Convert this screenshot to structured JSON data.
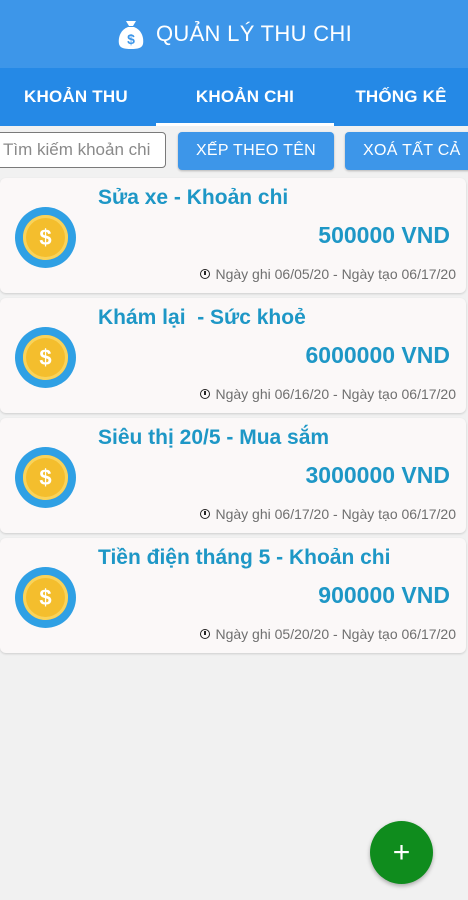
{
  "appbar": {
    "icon": "money-bag-icon",
    "title": "QUẢN LÝ THU CHI"
  },
  "tabs": [
    {
      "label": "KHOẢN THU",
      "active": false
    },
    {
      "label": "KHOẢN CHI",
      "active": true
    },
    {
      "label": "THỐNG KÊ",
      "active": false
    }
  ],
  "actions": {
    "search_placeholder": "Tìm kiếm khoản chi",
    "sort_label": "XẾP THEO TÊN",
    "clear_label": "XOÁ TẤT CẢ"
  },
  "items": [
    {
      "title": "Sửa xe - Khoản chi",
      "amount": "500000 VND",
      "dates": "Ngày ghi 06/05/20 - Ngày tạo 06/17/20"
    },
    {
      "title": "Khám lại  - Sức khoẻ",
      "amount": "6000000 VND",
      "dates": "Ngày ghi 06/16/20 - Ngày tạo 06/17/20"
    },
    {
      "title": "Siêu thị 20/5 - Mua sắm",
      "amount": "3000000 VND",
      "dates": "Ngày ghi 06/17/20 - Ngày tạo 06/17/20"
    },
    {
      "title": "Tiền điện tháng 5 - Khoản chi",
      "amount": "900000 VND",
      "dates": "Ngày ghi 05/20/20 - Ngày tạo 06/17/20"
    }
  ],
  "coin_symbol": "$",
  "fab": {
    "label": "+",
    "icon": "plus-icon"
  },
  "colors": {
    "appbar": "#3d96e9",
    "tabs": "#2589e6",
    "accent_text": "#1e97c6",
    "fab": "#0f8c1d"
  }
}
